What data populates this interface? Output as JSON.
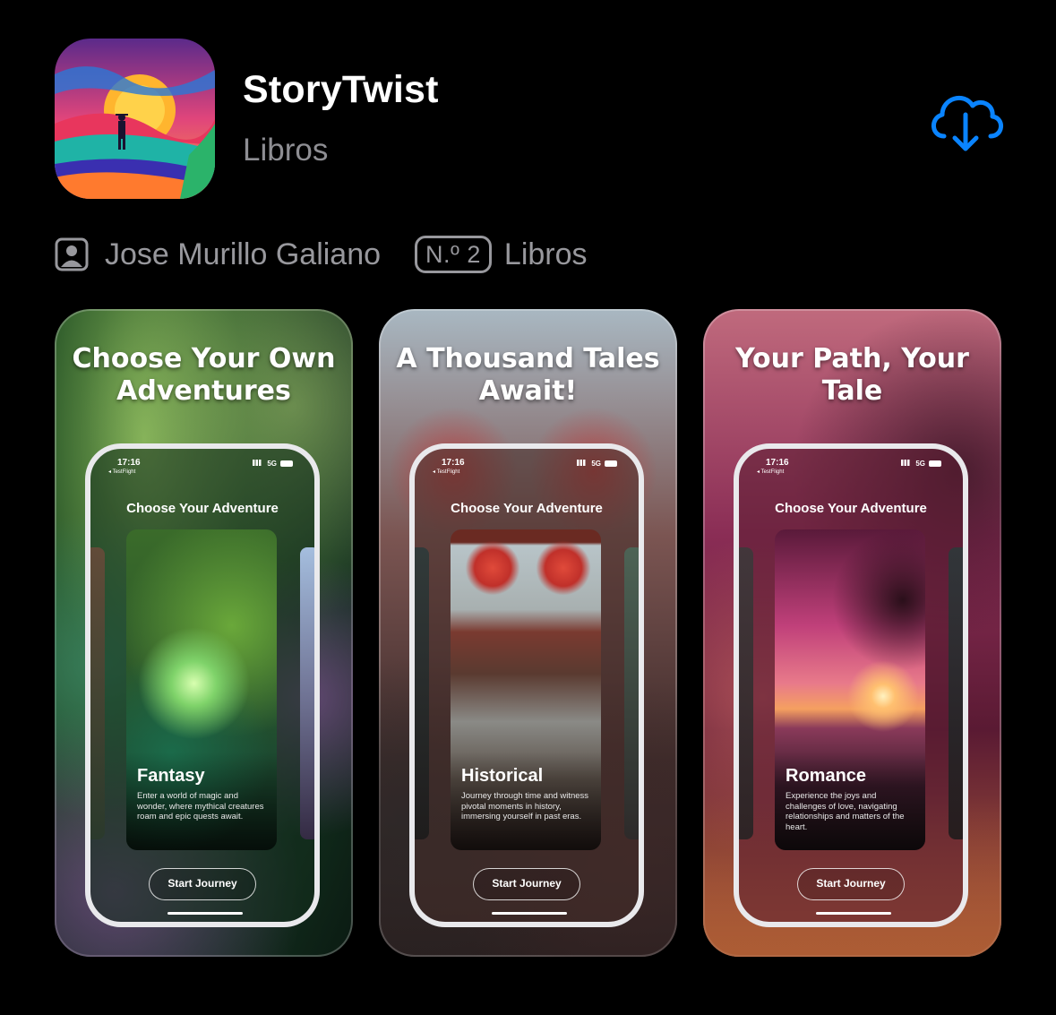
{
  "app": {
    "title": "StoryTwist",
    "category": "Libros",
    "icon": "app-icon-sunset-traveler",
    "download_icon": "cloud-download-icon",
    "accent_color": "#0a84ff"
  },
  "meta": {
    "developer_icon": "person-square-icon",
    "developer": "Jose Murillo Galiano",
    "rank_badge": "N.º 2",
    "rank_category": "Libros"
  },
  "screenshots": [
    {
      "headline": "Choose Your Own Adventures",
      "status_time": "17:16",
      "status_back": "◂ TestFlight",
      "status_network": "5G",
      "heading": "Choose Your Adventure",
      "card_title": "Fantasy",
      "card_desc": "Enter a world of magic and wonder, where mythical creatures roam and epic quests await.",
      "button": "Start Journey"
    },
    {
      "headline": "A Thousand Tales Await!",
      "status_time": "17:16",
      "status_back": "◂ TestFlight",
      "status_network": "5G",
      "heading": "Choose Your Adventure",
      "card_title": "Historical",
      "card_desc": "Journey through time and witness pivotal moments in history, immersing yourself in past eras.",
      "button": "Start Journey"
    },
    {
      "headline": "Your Path, Your Tale",
      "status_time": "17:16",
      "status_back": "◂ TestFlight",
      "status_network": "5G",
      "heading": "Choose Your Adventure",
      "card_title": "Romance",
      "card_desc": "Experience the joys and challenges of love, navigating relationships and matters of the heart.",
      "button": "Start Journey"
    }
  ]
}
